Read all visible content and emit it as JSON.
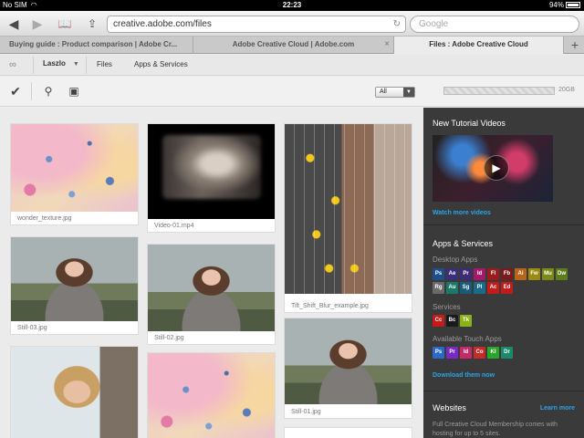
{
  "status": {
    "carrier": "No SIM",
    "time": "22:23",
    "battery": "94%"
  },
  "browser": {
    "url": "creative.adobe.com/files",
    "search_placeholder": "Google",
    "tabs": [
      {
        "label": "Buying guide : Product comparison | Adobe Cr..."
      },
      {
        "label": "Adobe Creative Cloud | Adobe.com"
      },
      {
        "label": "Files : Adobe Creative Cloud"
      }
    ]
  },
  "cc_header": {
    "user": "Laszlo",
    "nav": {
      "files": "Files",
      "apps": "Apps & Services"
    }
  },
  "files_toolbar": {
    "filter_value": "All",
    "storage_label": "20GB",
    "storage_used_fraction": 0.0
  },
  "files": [
    {
      "caption": "wonder_texture.jpg"
    },
    {
      "caption": "Video-01.mp4"
    },
    {
      "caption": "Tilt_Shift_Blur_example.jpg"
    },
    {
      "caption": "Still-03.jpg"
    },
    {
      "caption": "Still-02.jpg"
    },
    {
      "caption": "Still-01.jpg"
    },
    {
      "caption": ""
    },
    {
      "caption": ""
    },
    {
      "caption": ""
    }
  ],
  "sidebar": {
    "tutorials_title": "New Tutorial Videos",
    "watch_more": "Watch more videos",
    "apps_title": "Apps & Services",
    "desktop_apps_label": "Desktop Apps",
    "desktop_apps": [
      {
        "abbr": "Ps",
        "color": "#1c4f8c"
      },
      {
        "abbr": "Ae",
        "color": "#3a2f7a"
      },
      {
        "abbr": "Pr",
        "color": "#3f2a78"
      },
      {
        "abbr": "Id",
        "color": "#a3196c"
      },
      {
        "abbr": "Fl",
        "color": "#9a1c1c"
      },
      {
        "abbr": "Fb",
        "color": "#7a1a1a"
      },
      {
        "abbr": "Ai",
        "color": "#b8651a"
      },
      {
        "abbr": "Fw",
        "color": "#9a8a12"
      },
      {
        "abbr": "Mu",
        "color": "#7a8a12"
      },
      {
        "abbr": "Dw",
        "color": "#5b7d1a"
      },
      {
        "abbr": "Rg",
        "color": "#6a6a6a"
      },
      {
        "abbr": "Au",
        "color": "#1a7a6a"
      },
      {
        "abbr": "Sg",
        "color": "#1a5a7a"
      },
      {
        "abbr": "Pl",
        "color": "#1a6a8a"
      },
      {
        "abbr": "Ac",
        "color": "#c41a1a"
      },
      {
        "abbr": "Ed",
        "color": "#c41a1a"
      }
    ],
    "services_label": "Services",
    "services": [
      {
        "abbr": "Cc",
        "color": "#c41a1a"
      },
      {
        "abbr": "Bc",
        "color": "#1a1a1a"
      },
      {
        "abbr": "Tk",
        "color": "#8ab21a"
      }
    ],
    "touch_apps_label": "Available Touch Apps",
    "touch_apps": [
      {
        "abbr": "Ps",
        "color": "#2a6ac4"
      },
      {
        "abbr": "Pr",
        "color": "#7a2ac4"
      },
      {
        "abbr": "Id",
        "color": "#c42a6a"
      },
      {
        "abbr": "Co",
        "color": "#c42a2a"
      },
      {
        "abbr": "Kl",
        "color": "#2aa42a"
      },
      {
        "abbr": "Dr",
        "color": "#1a8a6a"
      }
    ],
    "download_link": "Download them now",
    "websites_title": "Websites",
    "learn_more": "Learn more",
    "websites_text": "Full Creative Cloud Membership comes with hosting for up to 5 sites."
  }
}
